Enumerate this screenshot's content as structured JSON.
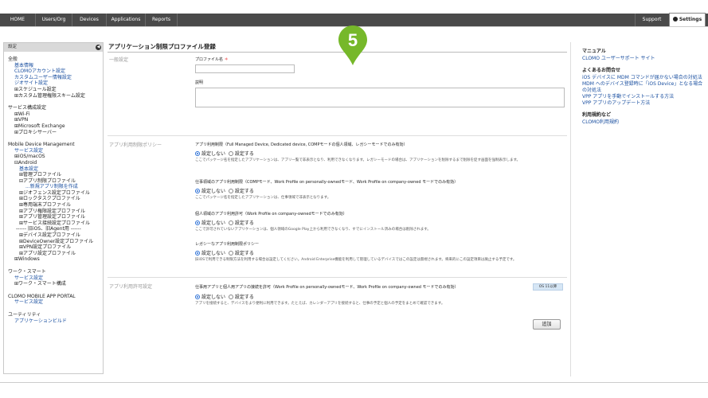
{
  "nav": {
    "home": "HOME",
    "users": "Users/Org",
    "devices": "Devices",
    "applications": "Applications",
    "reports": "Reports",
    "support": "Support",
    "settings": "Settings"
  },
  "sidebar": {
    "header": "設定",
    "general": {
      "title": "全般",
      "items": [
        "基本情報",
        "CLOMOアカウント設定",
        "カスタムユーザー情報設定",
        "ジオサイト設定",
        "⊞スケジュール設定",
        "⊞カスタム管理権限スキーム設定"
      ]
    },
    "service": {
      "title": "サービス構成設定",
      "items": [
        "⊞Wi-Fi",
        "⊞VPN",
        "⊞Microsoft Exchange",
        "⊞プロキシサーバー"
      ]
    },
    "mdm": {
      "title": "Mobile Device Management",
      "service_link": "サービス設定",
      "ios": "⊞iOS/macOS",
      "android": "⊟Android",
      "basic": "基本設定",
      "items": [
        "⊞管理プロファイル",
        "⊟アプリ制限プロファイル"
      ],
      "new_link": "...新規アプリ制限を作成",
      "items2": [
        "⊞ジオフェンス設定プロファイル",
        "⊞ロックタスクプロファイル",
        "⊞専用端末プロファイル",
        "⊞アプリ権限設定プロファイル",
        "⊞アプリ管理設定プロファイル",
        "⊞サービス接続設定プロファイル",
        "------ 旧iOS、旧Agent用 ------",
        "⊞デバイス設定プロファイル",
        "⊞DeviceOwner設定プロファイル",
        "⊞VPN設定プロファイル",
        "⊞アプリ設定プロファイル"
      ],
      "windows": "⊞Windows"
    },
    "work": {
      "title": "ワーク・スマート",
      "service_link": "サービス設定",
      "item": "⊞ワーク・スマート構成"
    },
    "portal": {
      "title": "CLOMO MOBILE APP PORTAL",
      "service_link": "サービス設定"
    },
    "utility": {
      "title": "ユーティリティ",
      "link": "アプリケーションビルド"
    }
  },
  "main": {
    "title": "アプリケーション制限プロファイル登録",
    "general": {
      "section": "一般設定",
      "profile_label": "プロファイル名",
      "required": "＊",
      "profile_value": "",
      "desc_label": "説明",
      "desc_value": ""
    },
    "policy": {
      "section": "アプリ利用制限ポリシー",
      "blocks": [
        {
          "label": "アプリ利用制限（Full Managed Device, Dedicated device, COMPモードの個人領域、レガシーモードでのみ有効）",
          "off": "設定しない",
          "on": "設定する",
          "desc": "ここでパッケージ名を指定したアプリケーションは、アプリ一覧で非表示となり、利用できなくなります。レガシーモードの場合は、アプリケーションを削除するまで削除を促す画面を強制表示します。"
        },
        {
          "label": "仕事領域のアプリ利用制限（COMPモード、Work Profile on personally-ownedモード、Work Profile on company-owned モードでのみ有効）",
          "off": "設定しない",
          "on": "設定する",
          "desc": "ここでパッケージ名を指定したアプリケーションは、仕事領域で非表示となります。"
        },
        {
          "label": "個人領域のアプリ利用許可（Work Profile on company-ownedモードでのみ有効）",
          "off": "設定しない",
          "on": "設定する",
          "desc": "ここで許可されていないアプリケーションは、個人領域のGoogle Play上から利用できなくなり、すでにインストール済みの場合は削除されます。"
        },
        {
          "label": "レガシーなアプリ利用制限ポリシー",
          "off": "設定しない",
          "on": "設定する",
          "desc": "旧iOSで利用できる制限方法を利用する場合は設定してください。Android Enterprise機能を利用して管理しているデバイスではこの設定は無視されます。将来的にこの設定項目は廃止する予定です。"
        }
      ]
    },
    "connect": {
      "section": "アプリ利用許可設定",
      "label": "仕事用アプリと個人用アプリの接続を許可（Work Profile on personally-ownedモード、Work Profile on company-owned モードでのみ有効）",
      "badge": "OS 11以降",
      "off": "設定しない",
      "on": "設定する",
      "desc": "アプリを接続すると、デバイスをより便利に利用できます。たとえば、カレンダーアプリを接続すると、仕事の予定と個人の予定をまとめて確認できます。"
    },
    "add_button": "追加"
  },
  "right": {
    "manual_title": "マニュアル",
    "manual_links": [
      "CLOMO ユーザーサポート サイト"
    ],
    "faq_title": "よくあるお問合せ",
    "faq_links": [
      "iOS デバイスに MDM コマンドが届かない場合の対処法",
      "MDM へのデバイス登録時に「iOS Device」となる場合の対処法",
      "VPP アプリを手動でインストールする方法",
      "VPP アプリのアップデート方法"
    ],
    "terms_title": "利用規約など",
    "terms_links": [
      "CLOMO利用規約"
    ]
  },
  "marker": {
    "number": "5",
    "color": "#76b82a"
  }
}
